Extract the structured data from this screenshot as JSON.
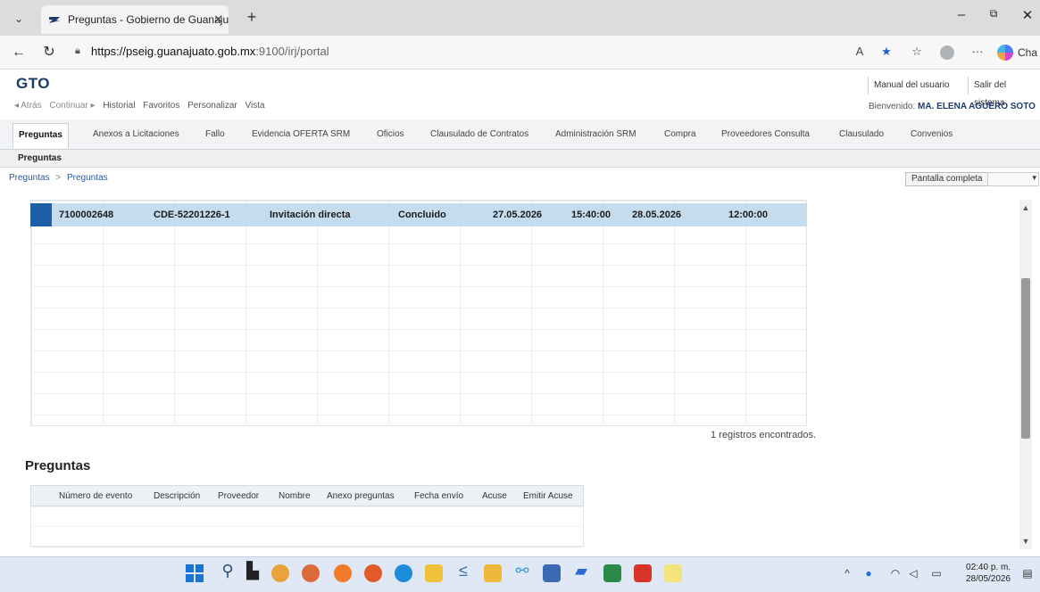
{
  "browser": {
    "tab_title": "Preguntas - Gobierno de Guanaju",
    "tab_close": "✕",
    "new_tab": "+",
    "url_host": "https://pseig.guanajuato.gob.mx",
    "url_rest": ":9100/irj/portal",
    "copilot_label": "Cha",
    "minimize": "–",
    "restore": "⧉",
    "close": "✕"
  },
  "portal": {
    "logo": "GTO",
    "header_buttons": [
      "Manual del usuario",
      "Salir del sistema"
    ],
    "nav_links": {
      "back": "◂ Atrás",
      "forward": "Continuar ▸",
      "history": "Historial",
      "favorites": "Favoritos",
      "customize": "Personalizar",
      "view": "Vista"
    },
    "welcome_prefix": "Bienvenido:",
    "welcome_user": "MA. ELENA AGUERO SOTO",
    "top_nav": [
      "Preguntas",
      "Anexos a Licitaciones",
      "Fallo",
      "Evidencia OFERTA SRM",
      "Oficios",
      "Clausulado de Contratos",
      "Administración SRM",
      "Compra",
      "Proveedores Consulta",
      "Clausulado",
      "Convenios"
    ],
    "sub_nav": "Preguntas",
    "breadcrumb": [
      "Preguntas",
      "Preguntas"
    ],
    "breadcrumb_sep": ">",
    "fullscreen_label": "Pantalla completa"
  },
  "events_table": {
    "rows": [
      {
        "number": "7100002648",
        "code": "CDE-52201226-1",
        "type": "Invitación directa",
        "status": "Concluido",
        "date_start": "27.05.2026",
        "time_start": "15:40:00",
        "date_end": "28.05.2026",
        "time_end": "12:00:00"
      }
    ],
    "records_found": "1 registros encontrados."
  },
  "questions": {
    "title": "Preguntas",
    "columns": [
      "Número de evento",
      "Descripción",
      "Proveedor",
      "Nombre",
      "Anexo preguntas",
      "Fecha envío",
      "Acuse",
      "Emitir Acuse"
    ]
  },
  "taskbar": {
    "time": "02:40 p. m.",
    "date": "28/05/2026"
  }
}
